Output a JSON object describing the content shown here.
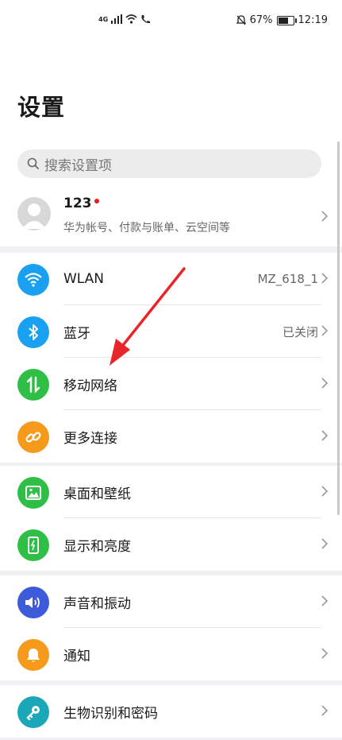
{
  "status_bar": {
    "network": "4G",
    "battery": "67%",
    "time": "12:19",
    "battery_level": 0.67
  },
  "page": {
    "title": "设置"
  },
  "search": {
    "placeholder": "搜索设置项"
  },
  "account": {
    "name": "123",
    "subtitle": "华为帐号、付款与账单、云空间等"
  },
  "connectivity": [
    {
      "label": "WLAN",
      "value": "MZ_618_1",
      "icon": "wifi-icon",
      "color": "#1aa0f0"
    },
    {
      "label": "蓝牙",
      "value": "已关闭",
      "icon": "bluetooth-icon",
      "color": "#1aa0f0"
    },
    {
      "label": "移动网络",
      "value": "",
      "icon": "mobile-data-icon",
      "color": "#2fbf47"
    },
    {
      "label": "更多连接",
      "value": "",
      "icon": "link-icon",
      "color": "#f59a1b"
    }
  ],
  "display": [
    {
      "label": "桌面和壁纸",
      "icon": "wallpaper-icon",
      "color": "#2fbf47"
    },
    {
      "label": "显示和亮度",
      "icon": "display-icon",
      "color": "#2fbf47"
    }
  ],
  "sound": [
    {
      "label": "声音和振动",
      "icon": "speaker-icon",
      "color": "#3d5bd9"
    },
    {
      "label": "通知",
      "icon": "bell-icon",
      "color": "#f59a1b"
    }
  ],
  "security": [
    {
      "label": "生物识别和密码",
      "icon": "key-icon",
      "color": "#1aa8b8"
    }
  ],
  "annotation": {
    "arrow_color": "#e8262a"
  }
}
